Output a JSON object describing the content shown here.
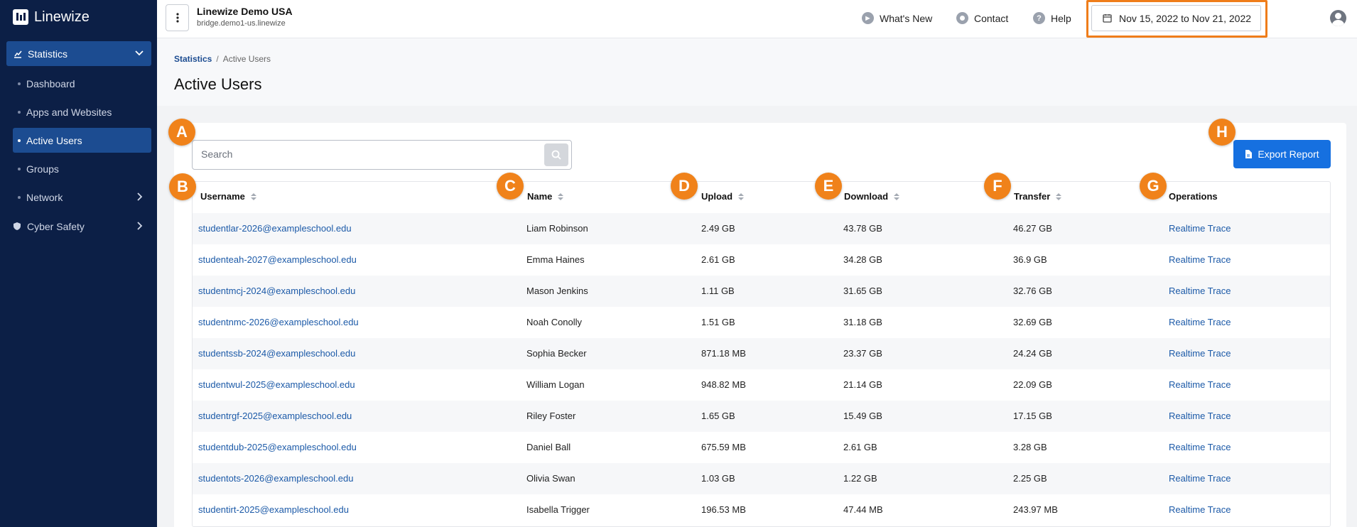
{
  "brand": {
    "name": "Linewize"
  },
  "sidebar": {
    "section": {
      "label": "Statistics"
    },
    "items": [
      {
        "label": "Dashboard",
        "active": false
      },
      {
        "label": "Apps and Websites",
        "active": false
      },
      {
        "label": "Active Users",
        "active": true
      },
      {
        "label": "Groups",
        "active": false
      },
      {
        "label": "Network",
        "active": false,
        "expandable": true
      }
    ],
    "bottom": {
      "label": "Cyber Safety",
      "expandable": true
    }
  },
  "topbar": {
    "org_name": "Linewize Demo USA",
    "org_host": "bridge.demo1-us.linewize",
    "whats_new": "What's New",
    "contact": "Contact",
    "help": "Help",
    "date_range": "Nov 15, 2022 to Nov 21, 2022"
  },
  "breadcrumb": {
    "parent": "Statistics",
    "separator": "/",
    "current": "Active Users"
  },
  "page_title": "Active Users",
  "search": {
    "placeholder": "Search",
    "value": ""
  },
  "export": {
    "label": "Export Report"
  },
  "badges": [
    "A",
    "B",
    "C",
    "D",
    "E",
    "F",
    "G",
    "H"
  ],
  "table": {
    "columns": [
      "Username",
      "Name",
      "Upload",
      "Download",
      "Transfer",
      "Operations"
    ],
    "rows": [
      {
        "username": "studentlar-2026@exampleschool.edu",
        "name": "Liam Robinson",
        "upload": "2.49 GB",
        "download": "43.78 GB",
        "transfer": "46.27 GB",
        "op": "Realtime Trace"
      },
      {
        "username": "studenteah-2027@exampleschool.edu",
        "name": "Emma Haines",
        "upload": "2.61 GB",
        "download": "34.28 GB",
        "transfer": "36.9 GB",
        "op": "Realtime Trace"
      },
      {
        "username": "studentmcj-2024@exampleschool.edu",
        "name": "Mason Jenkins",
        "upload": "1.11 GB",
        "download": "31.65 GB",
        "transfer": "32.76 GB",
        "op": "Realtime Trace"
      },
      {
        "username": "studentnmc-2026@exampleschool.edu",
        "name": "Noah Conolly",
        "upload": "1.51 GB",
        "download": "31.18 GB",
        "transfer": "32.69 GB",
        "op": "Realtime Trace"
      },
      {
        "username": "studentssb-2024@exampleschool.edu",
        "name": "Sophia Becker",
        "upload": "871.18 MB",
        "download": "23.37 GB",
        "transfer": "24.24 GB",
        "op": "Realtime Trace"
      },
      {
        "username": "studentwul-2025@exampleschool.edu",
        "name": "William Logan",
        "upload": "948.82 MB",
        "download": "21.14 GB",
        "transfer": "22.09 GB",
        "op": "Realtime Trace"
      },
      {
        "username": "studentrgf-2025@exampleschool.edu",
        "name": "Riley Foster",
        "upload": "1.65 GB",
        "download": "15.49 GB",
        "transfer": "17.15 GB",
        "op": "Realtime Trace"
      },
      {
        "username": "studentdub-2025@exampleschool.edu",
        "name": "Daniel Ball",
        "upload": "675.59 MB",
        "download": "2.61 GB",
        "transfer": "3.28 GB",
        "op": "Realtime Trace"
      },
      {
        "username": "studentots-2026@exampleschool.edu",
        "name": "Olivia Swan",
        "upload": "1.03 GB",
        "download": "1.22 GB",
        "transfer": "2.25 GB",
        "op": "Realtime Trace"
      },
      {
        "username": "studentirt-2025@exampleschool.edu",
        "name": "Isabella Trigger",
        "upload": "196.53 MB",
        "download": "47.44 MB",
        "transfer": "243.97 MB",
        "op": "Realtime Trace"
      }
    ]
  },
  "colors": {
    "sidebar_bg": "#0c1f46",
    "accent": "#1c4c91",
    "primary_button": "#1670e0",
    "badge": "#f0821a",
    "highlight": "#ef7d1a",
    "link": "#1c5aa8"
  }
}
